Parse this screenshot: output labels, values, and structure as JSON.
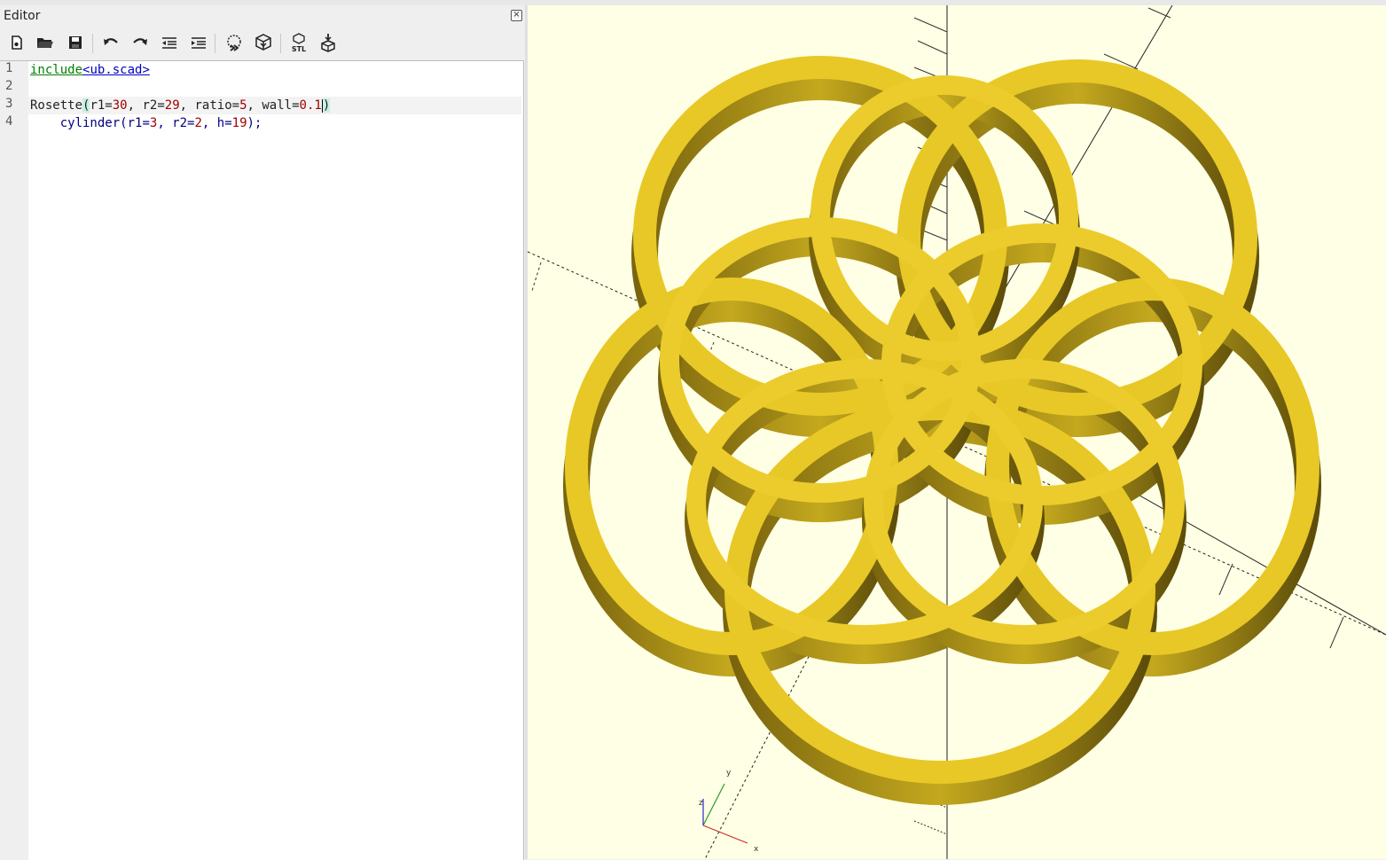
{
  "editor": {
    "title": "Editor",
    "close_glyph": "×",
    "toolbar": [
      {
        "name": "new-file-icon"
      },
      {
        "name": "open-file-icon"
      },
      {
        "name": "save-file-icon"
      },
      {
        "name": "undo-icon"
      },
      {
        "name": "redo-icon"
      },
      {
        "name": "unindent-icon"
      },
      {
        "name": "indent-icon"
      },
      {
        "name": "preview-icon"
      },
      {
        "name": "render-icon"
      },
      {
        "name": "export-stl-icon",
        "label": "STL"
      },
      {
        "name": "send-to-print-icon"
      }
    ],
    "line_numbers": [
      "1",
      "2",
      "3",
      "4"
    ],
    "lines": {
      "l1": {
        "kw": "include",
        "path": "<ub.scad>"
      },
      "l3": {
        "module": "Rosette",
        "open": "(",
        "a1": "r1=",
        "v1": "30",
        "s1": ", r2=",
        "v2": "29",
        "s2": ", ratio=",
        "v3": "5",
        "s3": ", wall=",
        "v4": "0.1",
        "close": ")"
      },
      "l4": {
        "indent": "    ",
        "fn": "cylinder",
        "open": "(",
        "a1": "r1=",
        "v1": "3",
        "s1": ", r2=",
        "v2": "2",
        "s2": ", h=",
        "v3": "19",
        "close": ");"
      }
    }
  },
  "viewer": {
    "background": "#ffffe5",
    "model_color": "#e8c826",
    "model_dark": "#4a3c08",
    "axis_labels": {
      "x": "x",
      "y": "y",
      "z": "z"
    }
  }
}
